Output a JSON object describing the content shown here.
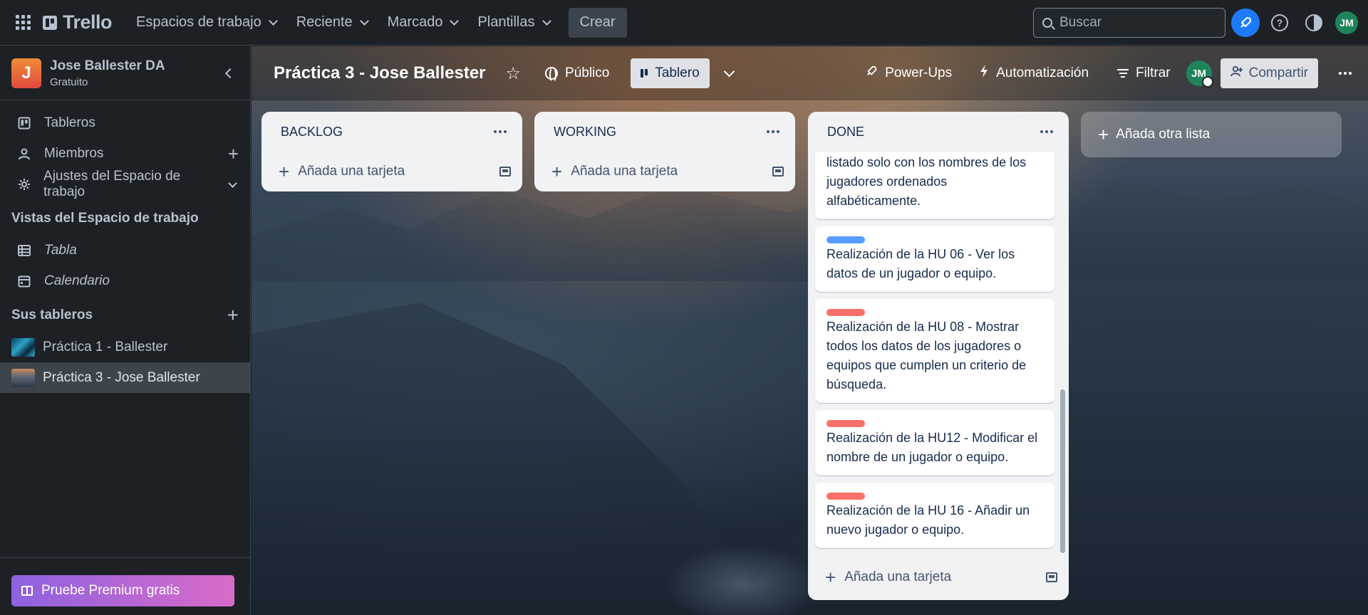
{
  "topbar": {
    "app_name": "Trello",
    "nav": [
      "Espacios de trabajo",
      "Reciente",
      "Marcado",
      "Plantillas"
    ],
    "create_label": "Crear",
    "search_placeholder": "Buscar",
    "avatar_initials": "JM"
  },
  "sidebar": {
    "workspace_initial": "J",
    "workspace_name": "Jose Ballester DA",
    "workspace_plan": "Gratuito",
    "items": [
      {
        "label": "Tableros",
        "icon": "board-icon"
      },
      {
        "label": "Miembros",
        "icon": "person-icon"
      },
      {
        "label": "Ajustes del Espacio de trabajo",
        "icon": "gear-icon"
      }
    ],
    "views_heading": "Vistas del Espacio de trabajo",
    "views": [
      {
        "label": "Tabla",
        "icon": "table-icon"
      },
      {
        "label": "Calendario",
        "icon": "calendar-icon"
      }
    ],
    "boards_heading": "Sus tableros",
    "boards": [
      {
        "label": "Práctica 1 - Ballester",
        "active": false
      },
      {
        "label": "Práctica 3 - Jose Ballester",
        "active": true
      }
    ],
    "premium_label": "Pruebe Premium gratis"
  },
  "board": {
    "title": "Práctica 3 - Jose Ballester",
    "visibility": "Público",
    "view_label": "Tablero",
    "power_ups": "Power-Ups",
    "automation": "Automatización",
    "filter": "Filtrar",
    "member_initials": "JM",
    "share": "Compartir",
    "add_list": "Añada otra lista"
  },
  "lists": [
    {
      "title": "BACKLOG",
      "add_card": "Añada una tarjeta"
    },
    {
      "title": "WORKING",
      "add_card": "Añada una tarjeta"
    },
    {
      "title": "DONE",
      "add_card": "Añada una tarjeta",
      "cards": [
        {
          "label_color": null,
          "text": "listado solo con los nombres de los jugadores ordenados alfabéticamente."
        },
        {
          "label_color": "#579dff",
          "text": "Realización de la HU 06 - Ver los datos de un jugador o equipo."
        },
        {
          "label_color": "#f87168",
          "text": "Realización de la HU 08 - Mostrar todos los datos de los jugadores o equipos que cumplen un criterio de búsqueda."
        },
        {
          "label_color": "#f87168",
          "text": "Realización de la HU12 - Modificar el nombre de un jugador o equipo."
        },
        {
          "label_color": "#f87168",
          "text": "Realización de la HU 16 - Añadir un nuevo jugador o equipo."
        }
      ]
    }
  ]
}
